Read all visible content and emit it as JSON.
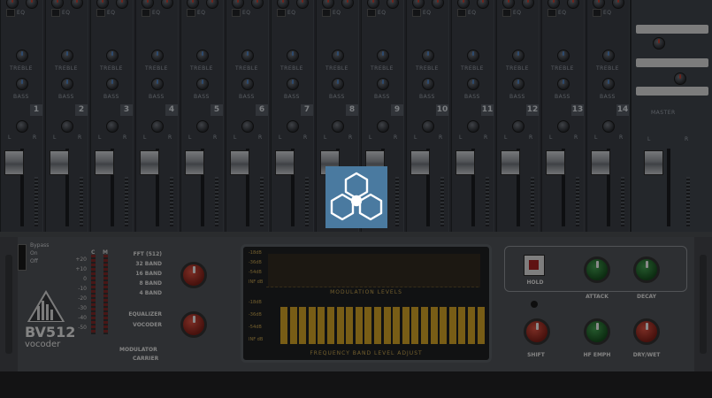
{
  "mixer": {
    "channel_numbers": [
      "1",
      "2",
      "3",
      "4",
      "5",
      "6",
      "7",
      "8",
      "9",
      "10",
      "11",
      "12",
      "13",
      "14"
    ],
    "eq_label": "EQ",
    "treble_label": "TREBLE",
    "bass_label": "BASS",
    "pan_left": "L",
    "pan_right": "R",
    "master_label": "MASTER"
  },
  "vocoder": {
    "model": "BV512",
    "subtitle": "vocoder",
    "switch_states": [
      "Bypass",
      "On",
      "Off"
    ],
    "meter_labels": {
      "carrier_short": "C",
      "modulator_short": "M"
    },
    "db_scale": [
      "+20",
      "+10",
      "0",
      "-10",
      "-20",
      "-30",
      "-40",
      "-50"
    ],
    "band_options": [
      "FFT (512)",
      "32 BAND",
      "16 BAND",
      "8 BAND",
      "4 BAND"
    ],
    "mode_options": [
      "EQUALIZER",
      "VOCODER"
    ],
    "modulator_label": "MODULATOR",
    "carrier_label": "CARRIER",
    "display": {
      "scale_top": [
        "-18dB",
        "-36dB",
        "-54dB",
        "INF dB"
      ],
      "scale_bottom": [
        "-18dB",
        "-36dB",
        "-54dB",
        "INF dB"
      ],
      "modulation_title": "MODULATION LEVELS",
      "band_title": "FREQUENCY BAND LEVEL ADJUST",
      "band_levels": [
        0.8,
        0.8,
        0.8,
        0.8,
        0.8,
        0.8,
        0.8,
        0.8,
        0.8,
        0.8,
        0.8,
        0.8,
        0.8,
        0.8,
        0.8,
        0.8,
        0.8,
        0.8,
        0.8,
        0.8,
        0.8,
        0.8
      ]
    },
    "hold_label": "HOLD",
    "attack_label": "ATTACK",
    "decay_label": "DECAY",
    "shift_label": "SHIFT",
    "hf_emph_label": "HF EMPH",
    "drywet_label": "DRY/WET"
  },
  "icons": {
    "app_logo": "reason-app-logo-icon"
  },
  "colors": {
    "accent_red": "#c0392b",
    "accent_green": "#2e8b3d",
    "display_amber": "#d2a020",
    "logo_blue": "#4a7aa0"
  }
}
